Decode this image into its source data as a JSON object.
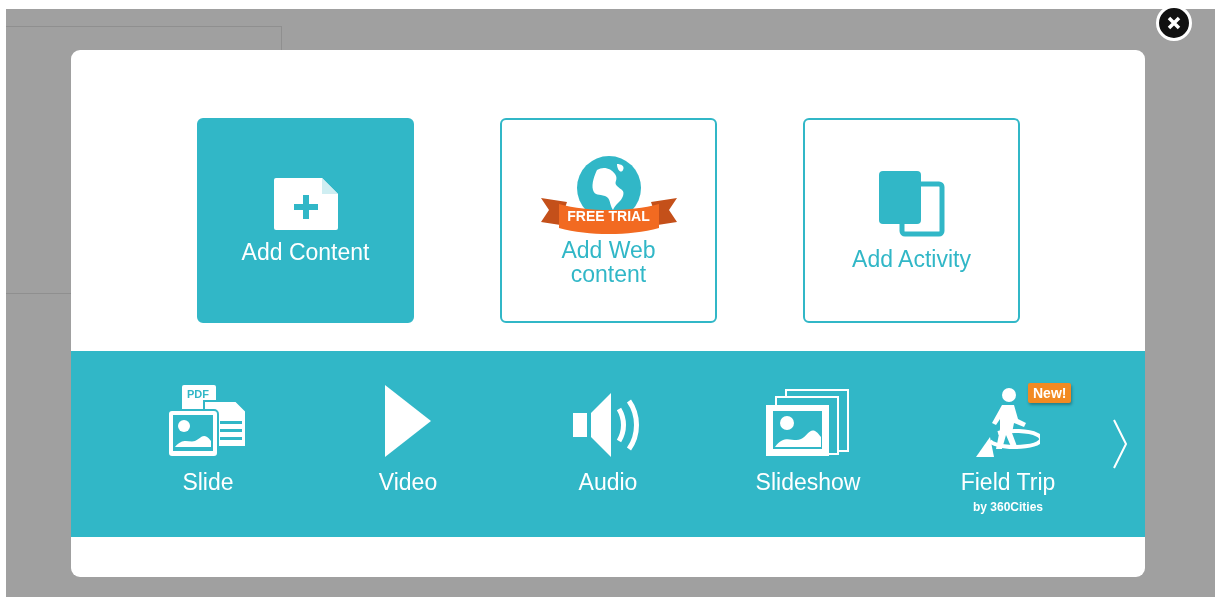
{
  "cards": [
    {
      "kind": "content",
      "label": "Add Content",
      "selected": true
    },
    {
      "kind": "web",
      "label": "Add Web content",
      "badge": "FREE TRIAL",
      "selected": false
    },
    {
      "kind": "activity",
      "label": "Add Activity",
      "selected": false
    }
  ],
  "media": [
    {
      "kind": "slide",
      "label": "Slide",
      "icon_text": "PDF"
    },
    {
      "kind": "video",
      "label": "Video"
    },
    {
      "kind": "audio",
      "label": "Audio"
    },
    {
      "kind": "slideshow",
      "label": "Slideshow"
    },
    {
      "kind": "fieldtrip",
      "label": "Field Trip",
      "sublabel": "by 360Cities",
      "badge": "New!"
    }
  ]
}
